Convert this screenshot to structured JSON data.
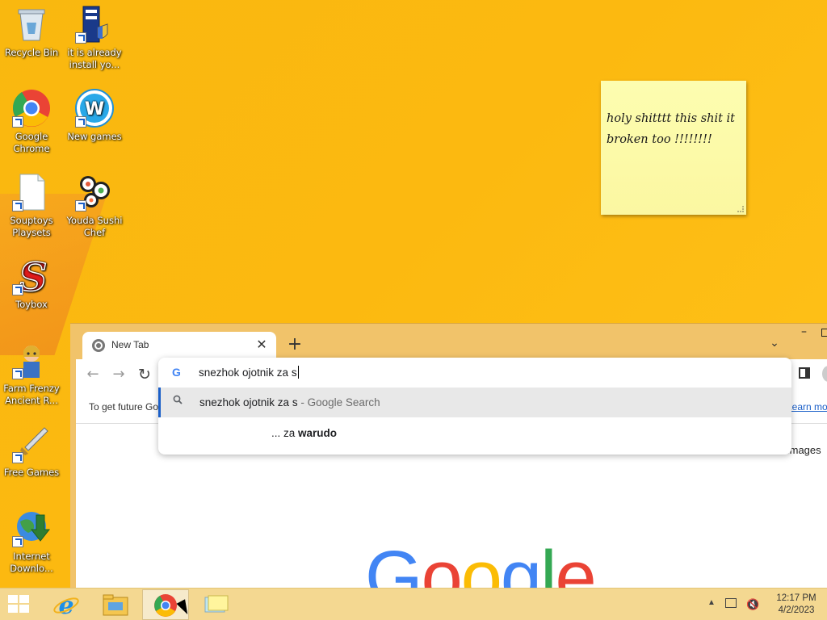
{
  "desktop": {
    "icons": [
      {
        "label": "Recycle Bin",
        "icon": "recycle-bin-icon"
      },
      {
        "label": "it is already install yo...",
        "icon": "installer-shield-icon"
      },
      {
        "label": "Google Chrome",
        "icon": "chrome-icon"
      },
      {
        "label": "New games",
        "icon": "w-games-icon"
      },
      {
        "label": "Souptoys Playsets",
        "icon": "blank-file-icon"
      },
      {
        "label": "Youda Sushi Chef",
        "icon": "sushi-icon"
      },
      {
        "label": "Toybox",
        "icon": "red-s-icon"
      },
      {
        "label": "Farm Frenzy Ancient R...",
        "icon": "farm-frenzy-icon"
      },
      {
        "label": "Free Games",
        "icon": "sword-icon"
      },
      {
        "label": "Internet Downlo...",
        "icon": "globe-download-icon"
      }
    ]
  },
  "sticky_note": {
    "text": "holy shitttt this shit it broken too !!!!!!!!",
    "color": "#fcf8a5"
  },
  "browser": {
    "tab": {
      "title": "New Tab",
      "close": "✕"
    },
    "new_tab": "+",
    "tab_search": "⌄",
    "window_min": "–",
    "nav": {
      "back": "←",
      "forward": "→",
      "reload": "↻"
    },
    "omnibox": {
      "value": "snezhok ojotnik za s",
      "icon": "G",
      "suggestions": [
        {
          "query": "snezhok ojotnik za s",
          "sep": " - ",
          "source": "Google Search"
        },
        {
          "prefix": "... za ",
          "bold": "warudo"
        }
      ]
    },
    "infobar": {
      "text": "To get future Google Chrome updates",
      "learn_more": "Learn more"
    },
    "images_link": "Images",
    "logo": {
      "g1": "G",
      "o1": "o",
      "o2": "o",
      "g2": "g",
      "l": "l",
      "e": "e"
    },
    "colors": {
      "blue": "#4285f4",
      "red": "#ea4335",
      "yellow": "#fbbc05",
      "green": "#34a853",
      "frame": "#f1c36a"
    }
  },
  "taskbar": {
    "items": [
      {
        "name": "internet-explorer",
        "icon": "ie-icon"
      },
      {
        "name": "file-explorer",
        "icon": "folder-icon"
      },
      {
        "name": "google-chrome",
        "icon": "chrome-icon",
        "active": true
      },
      {
        "name": "sticky-notes",
        "icon": "sticky-notes-icon"
      }
    ],
    "tray": {
      "show_hidden": "▲",
      "time": "12:17 PM",
      "date": "4/2/2023"
    }
  }
}
